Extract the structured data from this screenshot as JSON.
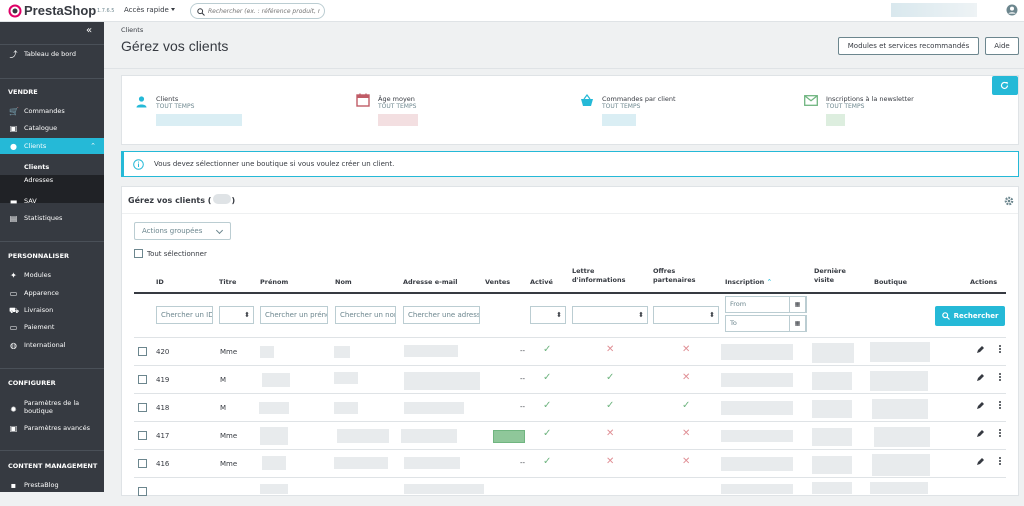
{
  "topbar": {
    "logo_text": "PrestaShop",
    "version": "1.7.6.5",
    "quick_access": "Accès rapide",
    "search_placeholder": "Rechercher (ex. : référence produit, nom"
  },
  "sidebar": {
    "dashboard": "Tableau de bord",
    "sections": {
      "sell": "VENDRE",
      "customize": "PERSONNALISER",
      "configure": "CONFIGURER",
      "content": "CONTENT MANAGEMENT"
    },
    "items": {
      "orders": "Commandes",
      "catalog": "Catalogue",
      "customers": "Clients",
      "sub_customers": "Clients",
      "sub_addresses": "Adresses",
      "sav": "SAV",
      "stats": "Statistiques",
      "modules": "Modules",
      "appearance": "Apparence",
      "shipping": "Livraison",
      "payment": "Paiement",
      "international": "International",
      "shop_params_1": "Paramètres de la",
      "shop_params_2": "boutique",
      "advanced_params": "Paramètres avancés",
      "prestablog": "PrestaBlog"
    }
  },
  "header": {
    "breadcrumb": "Clients",
    "title": "Gérez vos clients",
    "modules_button": "Modules et services recommandés",
    "help_button": "Aide"
  },
  "kpis": [
    {
      "title": "Clients",
      "sub": "TOUT TEMPS",
      "icon": "user-icon",
      "color": "#25b9d7"
    },
    {
      "title": "Âge moyen",
      "sub": "TOUT TEMPS",
      "icon": "calendar-icon",
      "color": "#c05c67"
    },
    {
      "title": "Commandes par client",
      "sub": "TOUT TEMPS",
      "icon": "basket-icon",
      "color": "#25b9d7"
    },
    {
      "title": "Inscriptions à la newsletter",
      "sub": "TOUT TEMPS",
      "icon": "envelope-icon",
      "color": "#70b580"
    }
  ],
  "alert": {
    "text": "Vous devez sélectionner une boutique si vous voulez créer un client."
  },
  "panel": {
    "title": "Gérez vos clients",
    "bulk_actions": "Actions groupées",
    "select_all": "Tout sélectionner"
  },
  "table": {
    "headers": {
      "id": "ID",
      "title": "Titre",
      "firstname": "Prénom",
      "lastname": "Nom",
      "email": "Adresse e-mail",
      "sales": "Ventes",
      "active": "Activé",
      "newsletter_1": "Lettre",
      "newsletter_2": "d'informations",
      "optin_1": "Offres",
      "optin_2": "partenaires",
      "date_add": "Inscription",
      "last_visit_1": "Dernière",
      "last_visit_2": "visite",
      "shop": "Boutique",
      "actions": "Actions"
    },
    "filters": {
      "id": "Chercher un ID",
      "firstname": "Chercher un prénom",
      "lastname": "Chercher un nom",
      "email": "Chercher une adresse",
      "from": "From",
      "to": "To",
      "search_button": "Rechercher"
    },
    "rows": [
      {
        "id": "420",
        "title": "Mme",
        "sales": "--",
        "active": true,
        "newsletter": false,
        "optin": false
      },
      {
        "id": "419",
        "title": "M",
        "sales": "--",
        "active": true,
        "newsletter": true,
        "optin": false
      },
      {
        "id": "418",
        "title": "M",
        "sales": "--",
        "active": true,
        "newsletter": true,
        "optin": true
      },
      {
        "id": "417",
        "title": "Mme",
        "sales": "",
        "active": true,
        "newsletter": false,
        "optin": false
      },
      {
        "id": "416",
        "title": "Mme",
        "sales": "--",
        "active": true,
        "newsletter": false,
        "optin": false
      }
    ]
  }
}
